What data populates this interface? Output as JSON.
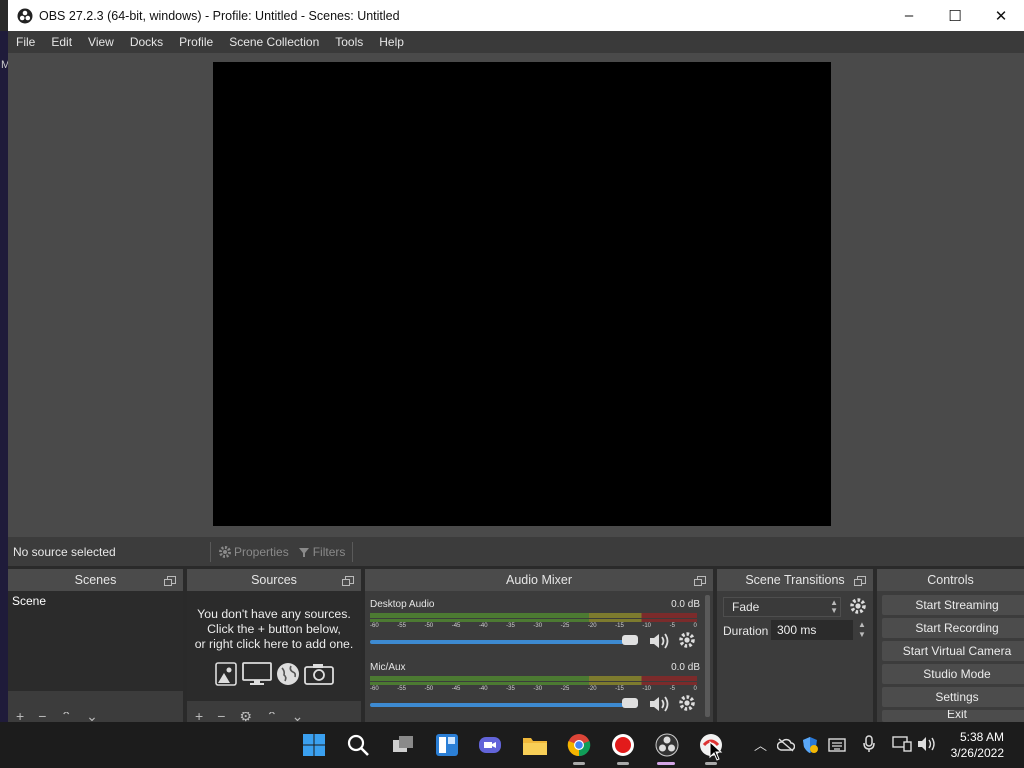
{
  "window": {
    "title": "OBS 27.2.3 (64-bit, windows) - Profile: Untitled - Scenes: Untitled",
    "minimize": "–",
    "maximize": "☐",
    "close": "✕"
  },
  "desktop_strip_text": "M",
  "menu": [
    "File",
    "Edit",
    "View",
    "Docks",
    "Profile",
    "Scene Collection",
    "Tools",
    "Help"
  ],
  "source_toolbar": {
    "status": "No source selected",
    "properties_label": "Properties",
    "filters_label": "Filters"
  },
  "scenes": {
    "title": "Scenes",
    "items": [
      "Scene"
    ]
  },
  "sources": {
    "title": "Sources",
    "empty_line1": "You don't have any sources.",
    "empty_line2": "Click the + button below,",
    "empty_line3": "or right click here to add one."
  },
  "mixer": {
    "title": "Audio Mixer",
    "ticks": [
      "-60",
      "-55",
      "-50",
      "-45",
      "-40",
      "-35",
      "-30",
      "-25",
      "-20",
      "-15",
      "-10",
      "-5",
      "0"
    ],
    "channels": [
      {
        "name": "Desktop Audio",
        "db": "0.0 dB"
      },
      {
        "name": "Mic/Aux",
        "db": "0.0 dB"
      }
    ]
  },
  "transitions": {
    "title": "Scene Transitions",
    "selected": "Fade",
    "duration_label": "Duration",
    "duration_value": "300 ms"
  },
  "controls": {
    "title": "Controls",
    "buttons": [
      "Start Streaming",
      "Start Recording",
      "Start Virtual Camera",
      "Studio Mode",
      "Settings",
      "Exit"
    ]
  },
  "taskbar": {
    "time": "5:38 AM",
    "date": "3/26/2022"
  },
  "colors": {
    "titlebar_bg": "#ffffff",
    "obs_bg": "#3c3c3c",
    "preview_bg": "#000000",
    "slider_accent": "#3d8ad1",
    "taskbar_bg": "#1c1c1c"
  }
}
